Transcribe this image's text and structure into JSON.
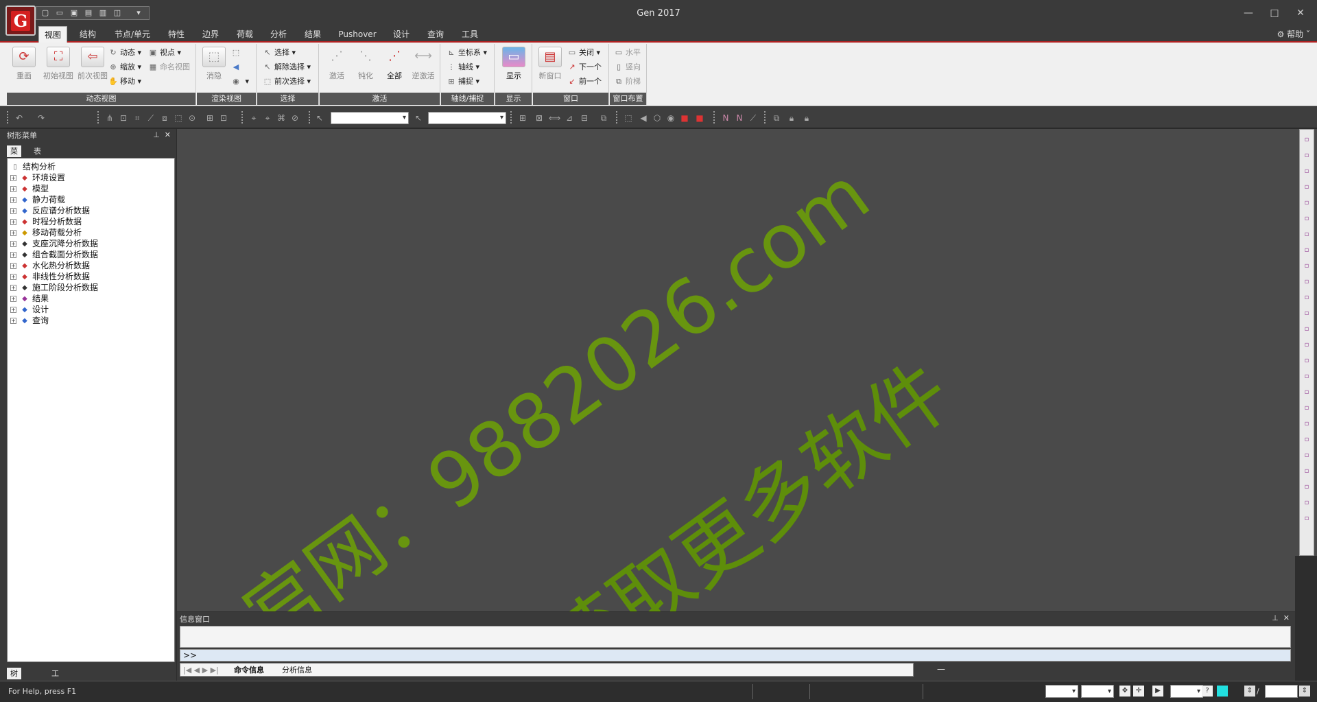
{
  "app": {
    "title": "Gen 2017",
    "logo_letter": "G"
  },
  "window_controls": {
    "minimize": "—",
    "maximize": "□",
    "close": "✕"
  },
  "qat": {
    "dropdown": "▾"
  },
  "tabs": [
    {
      "label": "视图",
      "active": true
    },
    {
      "label": "结构"
    },
    {
      "label": "节点/单元"
    },
    {
      "label": "特性"
    },
    {
      "label": "边界"
    },
    {
      "label": "荷载"
    },
    {
      "label": "分析"
    },
    {
      "label": "结果"
    },
    {
      "label": "Pushover"
    },
    {
      "label": "设计"
    },
    {
      "label": "查询"
    },
    {
      "label": "工具"
    }
  ],
  "help": {
    "label": "帮助"
  },
  "ribbon": {
    "dynamic_view": {
      "label": "动态视图",
      "redraw": "重画",
      "initial_view": "初始视图",
      "previous_view": "前次视图",
      "dynamic": "动态",
      "zoom": "缩放",
      "move": "移动",
      "viewpoint": "视点",
      "named_view": "命名视图"
    },
    "render_view": {
      "label": "渲染视图",
      "hide": "消隐"
    },
    "select": {
      "label": "选择",
      "select": "选择",
      "deselect": "解除选择",
      "previous_select": "前次选择"
    },
    "activate": {
      "label": "激活",
      "activate": "激活",
      "deactivate": "钝化",
      "all": "全部",
      "inverse": "逆激活"
    },
    "grid_snap": {
      "label": "轴线/捕捉",
      "coord": "坐标系",
      "grid": "轴线",
      "snap": "捕捉"
    },
    "display": {
      "label": "显示",
      "display": "显示"
    },
    "window": {
      "label": "窗口",
      "new_window": "新窗口",
      "close": "关闭",
      "next": "下一个",
      "previous": "前一个"
    },
    "window_layout": {
      "label": "窗口布置",
      "horizontal": "水平",
      "vertical": "竖向",
      "cascade": "阶梯"
    }
  },
  "left_panel": {
    "title": "树形菜单",
    "tabs": [
      "菜单",
      "表格"
    ],
    "tree": {
      "root": "结构分析",
      "items": [
        {
          "label": "环境设置",
          "icon": "settings-icon",
          "color": "#cc3333"
        },
        {
          "label": "模型",
          "icon": "model-icon",
          "color": "#cc3333"
        },
        {
          "label": "静力荷载",
          "icon": "static-load-icon",
          "color": "#3366cc"
        },
        {
          "label": "反应谱分析数据",
          "icon": "spectrum-icon",
          "color": "#3366cc"
        },
        {
          "label": "时程分析数据",
          "icon": "time-history-icon",
          "color": "#cc3333"
        },
        {
          "label": "移动荷载分析",
          "icon": "moving-load-icon",
          "color": "#cc9900"
        },
        {
          "label": "支座沉降分析数据",
          "icon": "settlement-icon",
          "color": "#333333"
        },
        {
          "label": "组合截面分析数据",
          "icon": "composite-section-icon",
          "color": "#333333"
        },
        {
          "label": "水化热分析数据",
          "icon": "hydration-heat-icon",
          "color": "#cc3333"
        },
        {
          "label": "非线性分析数据",
          "icon": "nonlinear-icon",
          "color": "#cc3333"
        },
        {
          "label": "施工阶段分析数据",
          "icon": "construction-stage-icon",
          "color": "#333333"
        },
        {
          "label": "结果",
          "icon": "result-icon",
          "color": "#993399"
        },
        {
          "label": "设计",
          "icon": "design-icon",
          "color": "#3366cc"
        },
        {
          "label": "查询",
          "icon": "query-icon",
          "color": "#3366cc"
        }
      ]
    },
    "bottom_tabs": [
      "树形菜单",
      "工作面板"
    ]
  },
  "watermark": {
    "line1": "官网：9882026.com",
    "line2": "获取更多软件"
  },
  "message_window": {
    "title": "信息窗口",
    "prompt": ">>",
    "tabs": [
      "命令信息",
      "分析信息"
    ],
    "dash": "—"
  },
  "status_bar": {
    "text": "For Help, press F1",
    "slash": "/"
  }
}
